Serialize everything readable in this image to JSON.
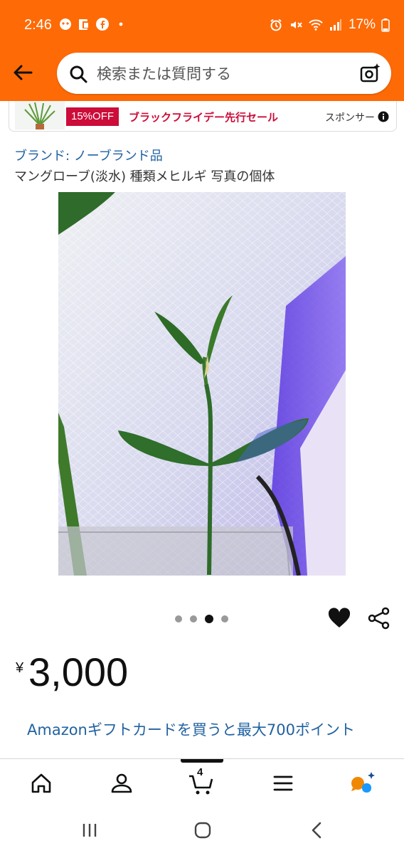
{
  "status_bar": {
    "time": "2:46",
    "battery_percent": "17%"
  },
  "search": {
    "placeholder": "検索または質問する"
  },
  "sponsored": {
    "discount_badge": "15%OFF",
    "deal_text": "ブラックフライデー先行セール",
    "sponsor_label": "スポンサー"
  },
  "product": {
    "brand": "ブランド: ノーブランド品",
    "title": "マングローブ(淡水) 種類メヒルギ 写真の個体",
    "image_count": 4,
    "active_image_index": 2,
    "currency_symbol": "¥",
    "price": "3,000",
    "gift_promo": "Amazonギフトカードを買うと最大700ポイント"
  },
  "bottom_nav": {
    "cart_count": "4"
  },
  "colors": {
    "header_orange": "#fe6a06",
    "link_blue": "#2162a1",
    "deal_red": "#cc0c39"
  }
}
